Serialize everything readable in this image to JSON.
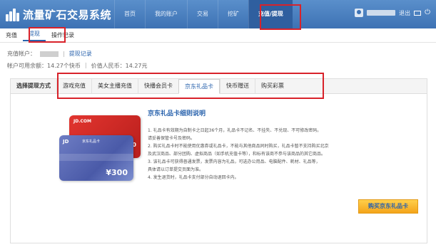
{
  "app": {
    "title": "流量矿石交易系统"
  },
  "nav": {
    "items": [
      {
        "label": "首页",
        "active": false
      },
      {
        "label": "我的账户",
        "active": false
      },
      {
        "label": "交易",
        "active": false
      },
      {
        "label": "挖矿",
        "active": false
      },
      {
        "label": "充值/提现",
        "active": true
      }
    ]
  },
  "user": {
    "exit": "退出"
  },
  "subtabs": [
    {
      "label": "充值",
      "active": false
    },
    {
      "label": "提现",
      "active": true
    },
    {
      "label": "操作记录",
      "active": false
    }
  ],
  "account": {
    "label": "充值帐户：",
    "link": "提现记录",
    "balance": "帐户可用余额：14.27个快币",
    "value": "价值人民币：14.27元"
  },
  "methods": {
    "label": "选择提现方式",
    "tabs": [
      {
        "label": "游戏充值",
        "active": false
      },
      {
        "label": "美女主播充值",
        "active": false
      },
      {
        "label": "快播会员卡",
        "active": false
      },
      {
        "label": "京东礼品卡",
        "active": true
      },
      {
        "label": "快币赠送",
        "active": false
      },
      {
        "label": "购买彩票",
        "active": false
      }
    ]
  },
  "cards": {
    "red_logo": "JD.COM",
    "red_value": "50",
    "blue_logo": "JD",
    "blue_title": "京东礼品卡",
    "blue_value": "¥300"
  },
  "instructions": {
    "title": "京东礼品卡细则说明",
    "items": [
      "1. 礼品卡有效期为自制卡之日起36个月，礼品卡不记名、不挂失、不兑现、不可修改密码。",
      "   请妥善保管卡号及密码。",
      "2. 购买礼品卡时不能使用优惠券或礼品卡，不能与其他商品同时购买，礼品卡暂不支持购买北京",
      "   及武汉商品、部分团购、虚拟商品（如手机充值卡等），和标有该商不参与该商品的其它商品。",
      "3. 该礼品卡可获得普通发票，发票内容为礼品，可选办公用品、电脑配件、耗材、礼品等，",
      "   具体请以订单提交页面为准。",
      "4. 发生退货时，礼品卡支付部分自动退回卡内。"
    ]
  },
  "buy_button": "购买京东礼品卡"
}
